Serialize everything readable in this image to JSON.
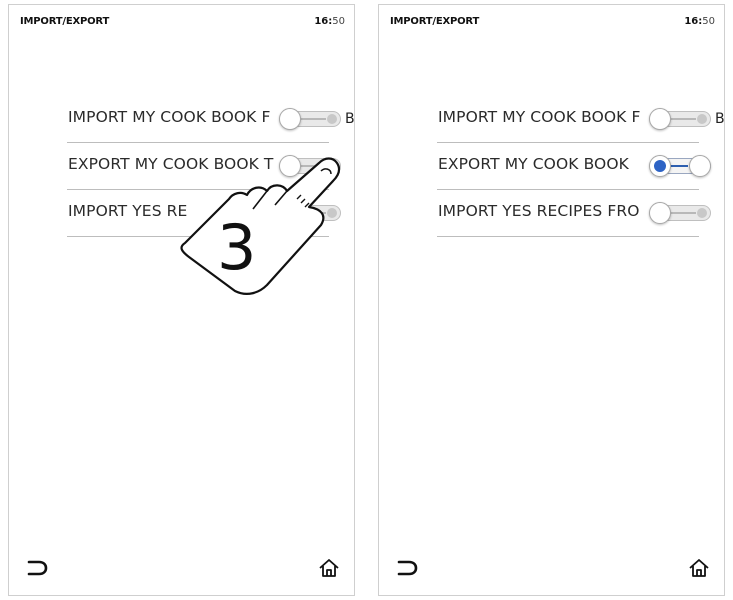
{
  "screens": [
    {
      "title": "IMPORT/EXPORT",
      "clock_hour": "16:",
      "clock_min": "50",
      "rows": [
        {
          "label": "IMPORT MY COOK BOOK F",
          "trail": "B",
          "toggle": "off"
        },
        {
          "label": "EXPORT MY COOK BOOK T",
          "trail": "",
          "toggle": "off"
        },
        {
          "label": "IMPORT YES RE",
          "trail": "",
          "toggle": "off"
        }
      ],
      "gesture_step": "3",
      "nav": {
        "back_icon": "back-arrow-icon",
        "home_icon": "home-icon"
      }
    },
    {
      "title": "IMPORT/EXPORT",
      "clock_hour": "16:",
      "clock_min": "50",
      "rows": [
        {
          "label": "IMPORT MY COOK BOOK F",
          "trail": "B",
          "toggle": "off"
        },
        {
          "label": "EXPORT MY COOK BOOK",
          "trail": "",
          "toggle": "on"
        },
        {
          "label": "IMPORT YES RECIPES FRO",
          "trail": "",
          "toggle": "off"
        }
      ],
      "nav": {
        "back_icon": "back-arrow-icon",
        "home_icon": "home-icon"
      }
    }
  ],
  "colors": {
    "accent": "#2d63c5",
    "divider": "#bdbdbd",
    "border": "#cfcfcf"
  }
}
